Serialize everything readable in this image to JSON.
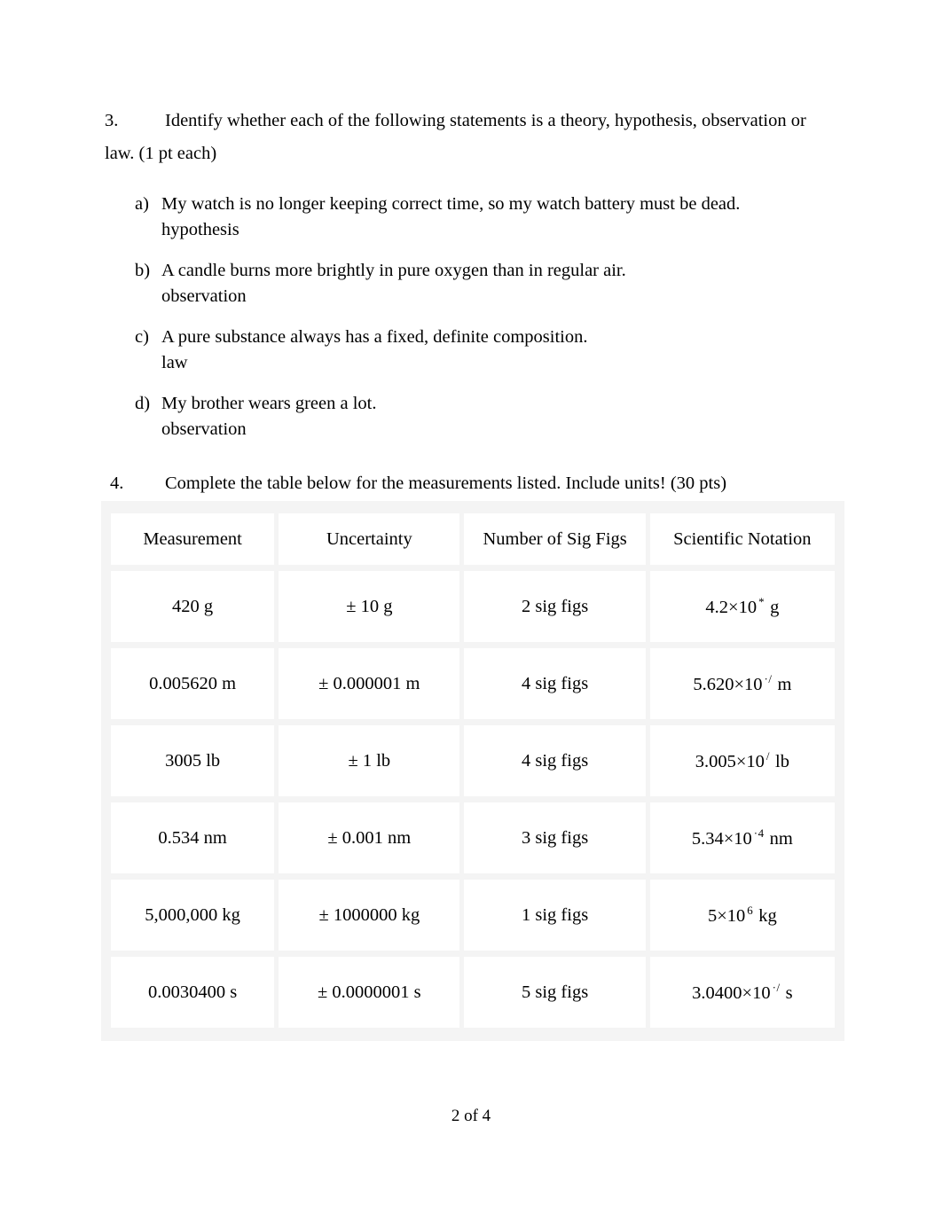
{
  "question3": {
    "number": "3.",
    "prompt": "Identify whether each of the following statements is a theory, hypothesis, observation or law. (1 pt each)",
    "items": [
      {
        "letter": "a)",
        "statement": "My watch is no longer keeping correct time, so my watch battery must be dead.",
        "answer": "hypothesis"
      },
      {
        "letter": "b)",
        "statement": "A candle burns more brightly in pure oxygen than in regular air.",
        "answer": "observation"
      },
      {
        "letter": "c)",
        "statement": "A pure substance always has a fixed, definite composition.",
        "answer": "law"
      },
      {
        "letter": "d)",
        "statement": "My brother wears green a lot.",
        "answer": "observation"
      }
    ]
  },
  "question4": {
    "number": "4.",
    "prompt": "Complete the table below for the measurements listed. Include units!   (30 pts)",
    "table": {
      "headers": [
        "Measurement",
        "Uncertainty",
        "Number of Sig Figs",
        "Scientific Notation"
      ],
      "rows": [
        {
          "measurement": "420 g",
          "uncertainty": "± 10 g",
          "sig_figs": "2 sig figs",
          "sci_mantissa": "4.2×10",
          "sci_exponent": "*",
          "sci_unit": "g"
        },
        {
          "measurement": "0.005620 m",
          "uncertainty": "± 0.000001 m",
          "sig_figs": "4 sig figs",
          "sci_mantissa": "5.620×10",
          "sci_exponent": "·/",
          "sci_unit": "m"
        },
        {
          "measurement": "3005 lb",
          "uncertainty": "± 1 lb",
          "sig_figs": "4 sig figs",
          "sci_mantissa": "3.005×10",
          "sci_exponent": "/",
          "sci_unit": "lb"
        },
        {
          "measurement": "0.534 nm",
          "uncertainty": "± 0.001 nm",
          "sig_figs": "3 sig figs",
          "sci_mantissa": "5.34×10",
          "sci_exponent": "·4",
          "sci_unit": "nm"
        },
        {
          "measurement": "5,000,000 kg",
          "uncertainty": "± 1000000 kg",
          "sig_figs": "1 sig figs",
          "sci_mantissa": "5×10",
          "sci_exponent": "6",
          "sci_unit": "kg"
        },
        {
          "measurement": "0.0030400 s",
          "uncertainty": "± 0.0000001 s",
          "sig_figs": "5 sig figs",
          "sci_mantissa": "3.0400×10",
          "sci_exponent": "·/",
          "sci_unit": "s"
        }
      ]
    }
  },
  "footer": {
    "page_label": "2 of 4"
  }
}
